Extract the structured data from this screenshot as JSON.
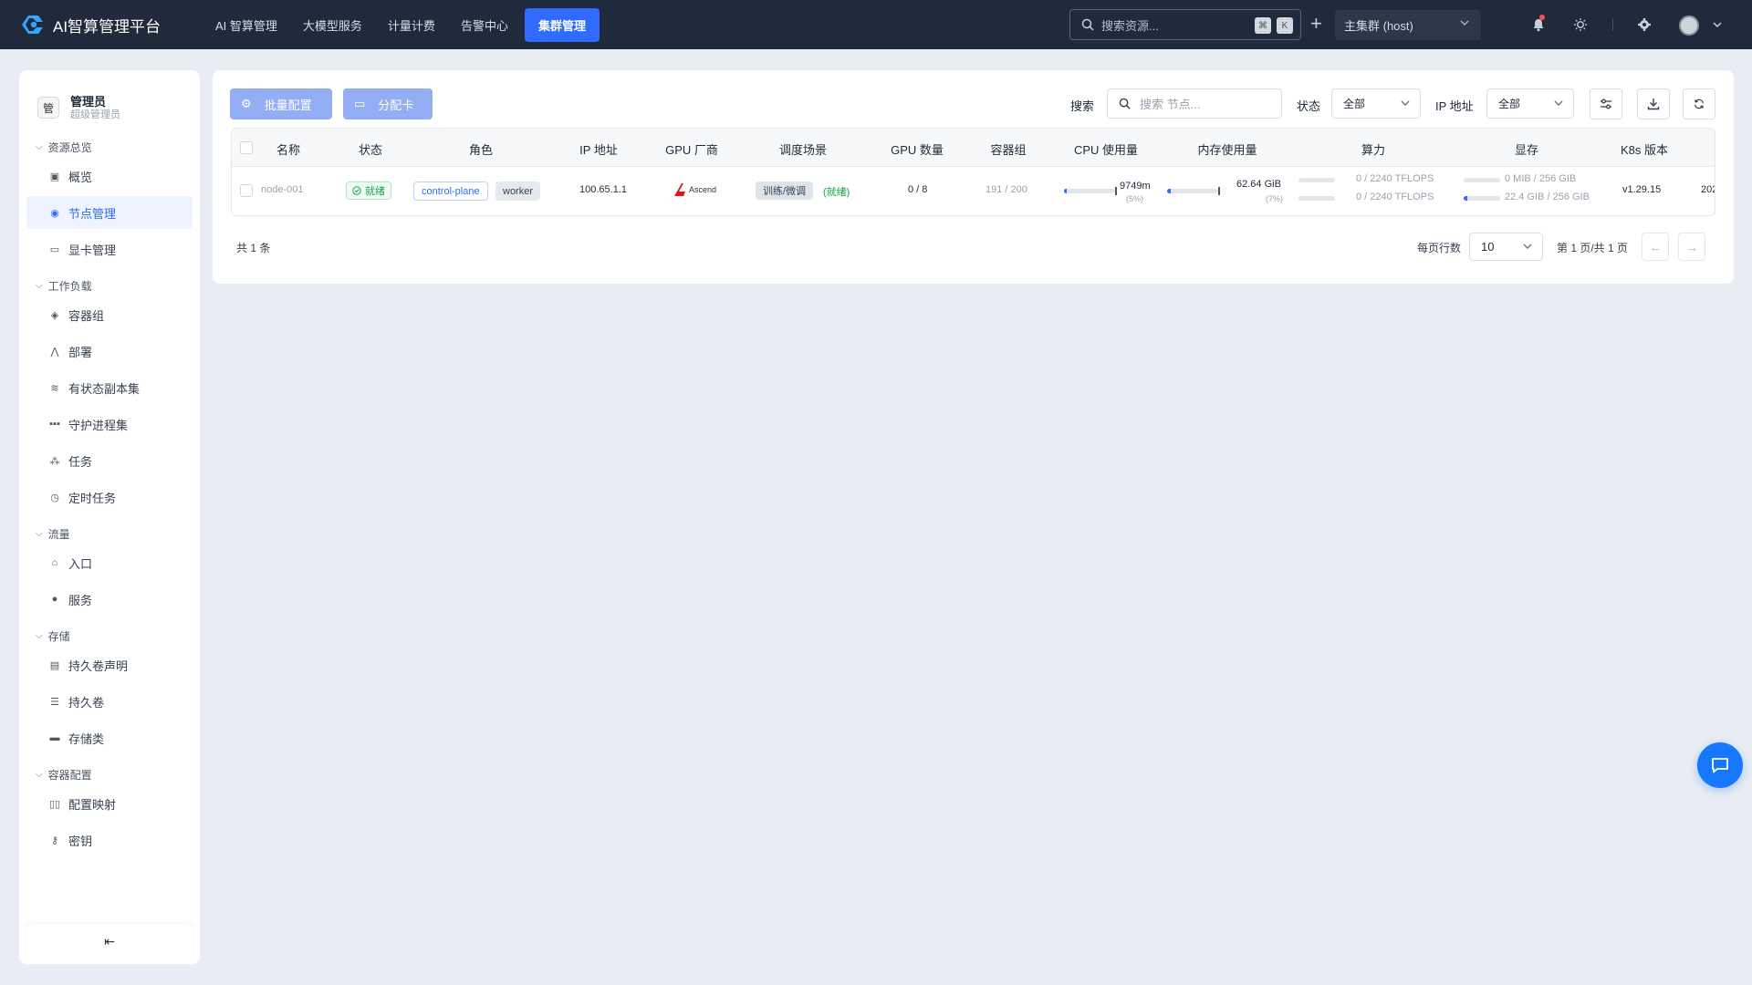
{
  "app": {
    "title": "AI智算管理平台"
  },
  "topnav": {
    "items": [
      "AI 智算管理",
      "大模型服务",
      "计量计费",
      "告警中心"
    ],
    "active": "集群管理"
  },
  "search": {
    "placeholder": "搜索资源...",
    "kbd1": "⌘",
    "kbd2": "K"
  },
  "cluster": {
    "selected": "主集群 (host)"
  },
  "user": {
    "name": "管理员",
    "role": "超级管理员",
    "avatar_char": "管"
  },
  "sidebar": {
    "groups": [
      {
        "title": "资源总览",
        "items": [
          {
            "label": "概览",
            "icon": "dashboard-icon"
          },
          {
            "label": "节点管理",
            "icon": "node-icon",
            "active": true
          },
          {
            "label": "显卡管理",
            "icon": "gpu-card-icon"
          }
        ]
      },
      {
        "title": "工作负载",
        "items": [
          {
            "label": "容器组",
            "icon": "pod-icon"
          },
          {
            "label": "部署",
            "icon": "deployment-icon"
          },
          {
            "label": "有状态副本集",
            "icon": "statefulset-icon"
          },
          {
            "label": "守护进程集",
            "icon": "daemonset-icon"
          },
          {
            "label": "任务",
            "icon": "job-icon"
          },
          {
            "label": "定时任务",
            "icon": "cronjob-icon"
          }
        ]
      },
      {
        "title": "流量",
        "items": [
          {
            "label": "入口",
            "icon": "ingress-icon"
          },
          {
            "label": "服务",
            "icon": "service-icon"
          }
        ]
      },
      {
        "title": "存储",
        "items": [
          {
            "label": "持久卷声明",
            "icon": "pvc-icon"
          },
          {
            "label": "持久卷",
            "icon": "pv-icon"
          },
          {
            "label": "存储类",
            "icon": "storageclass-icon"
          }
        ]
      },
      {
        "title": "容器配置",
        "items": [
          {
            "label": "配置映射",
            "icon": "configmap-icon"
          },
          {
            "label": "密钥",
            "icon": "secret-icon"
          }
        ]
      }
    ]
  },
  "toolbar": {
    "batch_config": "批量配置",
    "assign_gpu": "分配卡",
    "search_label": "搜索",
    "search_placeholder": "搜索 节点...",
    "status_label": "状态",
    "status_value": "全部",
    "ip_label": "IP 地址",
    "ip_value": "全部"
  },
  "table": {
    "columns": [
      "名称",
      "状态",
      "角色",
      "IP 地址",
      "GPU 厂商",
      "调度场景",
      "GPU 数量",
      "容器组",
      "CPU 使用量",
      "内存使用量",
      "算力",
      "显存",
      "K8s 版本"
    ],
    "rows": [
      {
        "name": "node-001",
        "status": "就绪",
        "roles": [
          "control-plane",
          "worker"
        ],
        "ip": "100.65.1.1",
        "gpu_vendor": "Ascend",
        "scene": "训练/微调",
        "scene_status": "(就绪)",
        "gpu_count": "0 / 8",
        "pods": "191 / 200",
        "cpu_value": "9749m",
        "cpu_pct": "(5%)",
        "cpu_fraction": 0.05,
        "mem_value": "62.64 GiB",
        "mem_pct": "(7%)",
        "mem_fraction": 0.07,
        "compute": [
          "0 / 2240 TFLOPS",
          "0 / 2240 TFLOPS"
        ],
        "vram": [
          "0 MIB / 256 GIB",
          "22.4 GIB / 256 GIB"
        ],
        "vram_fraction": [
          0.0,
          0.0875
        ],
        "k8s_version": "v1.29.15",
        "created_partial": "202"
      }
    ]
  },
  "footer": {
    "total": "共 1 条",
    "rows_per_page_label": "每页行数",
    "rows_per_page": "10",
    "page_info": "第 1 页/共 1 页"
  },
  "colors": {
    "accent": "#2f6bff",
    "topbar": "#1f2a3d",
    "success": "#16a34a",
    "ascend_red": "#d7161e"
  }
}
